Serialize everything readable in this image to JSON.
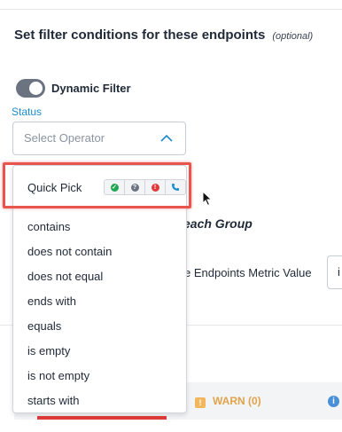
{
  "section": {
    "heading": "Set filter conditions for these endpoints",
    "optional": "(optional)"
  },
  "filter": {
    "toggle_label": "Dynamic Filter",
    "toggle_on": true
  },
  "status": {
    "label": "Status",
    "placeholder": "Select Operator"
  },
  "menu": {
    "quick_pick_label": "Quick Pick",
    "quick_pick_icons": [
      "check-circle-icon",
      "question-circle-icon",
      "alert-circle-icon",
      "phone-icon"
    ],
    "items": [
      "contains",
      "does not contain",
      "does not equal",
      "ends with",
      "equals",
      "is empty",
      "is not empty",
      "starts with"
    ]
  },
  "background": {
    "group_text": "each Group",
    "metric_text": "e Endpoints Metric Value",
    "metric_input": "i",
    "warn_label": "WARN (0)",
    "warn_icon": "!",
    "info_icon": "i"
  },
  "colors": {
    "accent": "#1a8ccc",
    "highlight": "#e8554e",
    "ok": "#22a652",
    "unknown": "#6b7280",
    "critical": "#e03b3b",
    "phone": "#1a8ccc",
    "warn": "#e0a34a"
  }
}
